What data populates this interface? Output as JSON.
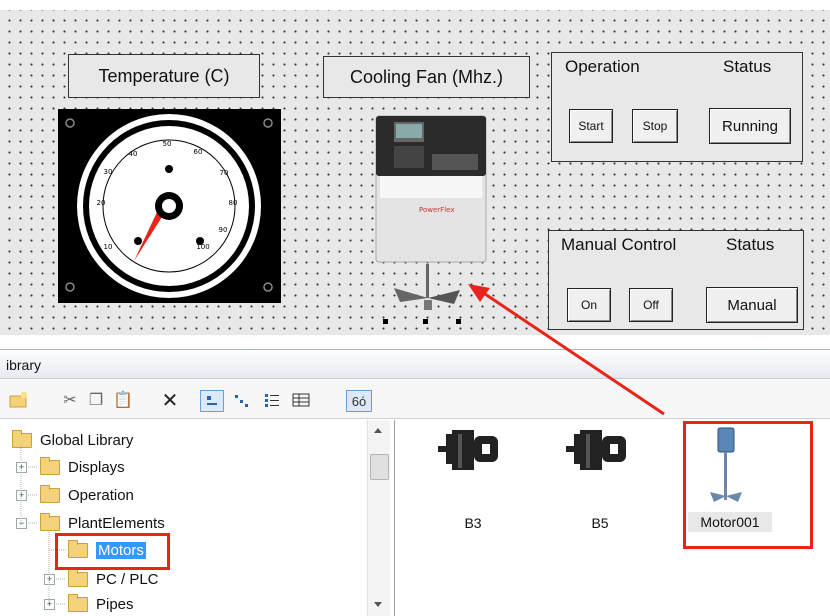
{
  "canvas": {
    "temperature_label": "Temperature (C)",
    "cooling_fan_label": "Cooling Fan (Mhz.)",
    "operation_group": {
      "title_left": "Operation",
      "title_right": "Status",
      "start_label": "Start",
      "stop_label": "Stop",
      "status_value": "Running"
    },
    "manual_group": {
      "title_left": "Manual Control",
      "title_right": "Status",
      "on_label": "On",
      "off_label": "Off",
      "status_value": "Manual"
    },
    "gauge": {
      "ticks": [
        "10",
        "20",
        "30",
        "40",
        "50",
        "60",
        "70",
        "80",
        "90",
        "100"
      ],
      "needle_color": "#e8241b"
    },
    "drive_brand": "PowerFlex"
  },
  "library": {
    "title": "ibrary",
    "toolbar_icons": [
      "new-folder-icon",
      "cut-icon",
      "copy-icon",
      "paste-icon",
      "delete-icon",
      "large-icons-view-icon",
      "small-icons-view-icon",
      "list-view-icon",
      "details-view-icon",
      "preview-icon"
    ],
    "tree": [
      {
        "label": "Global Library",
        "expander": ""
      },
      {
        "label": "Displays",
        "expander": "+"
      },
      {
        "label": "Operation",
        "expander": "+"
      },
      {
        "label": "PlantElements",
        "expander": "−"
      },
      {
        "label": "Motors",
        "expander": "",
        "selected": true
      },
      {
        "label": "PC / PLC",
        "expander": "+"
      },
      {
        "label": "Pipes",
        "expander": "+"
      }
    ],
    "items": [
      {
        "label": "B3",
        "icon": "motor-icon"
      },
      {
        "label": "B5",
        "icon": "motor-icon"
      },
      {
        "label": "Motor001",
        "icon": "agitator-motor-icon"
      }
    ]
  },
  "annotation": {
    "highlight_color": "#e8241b"
  }
}
